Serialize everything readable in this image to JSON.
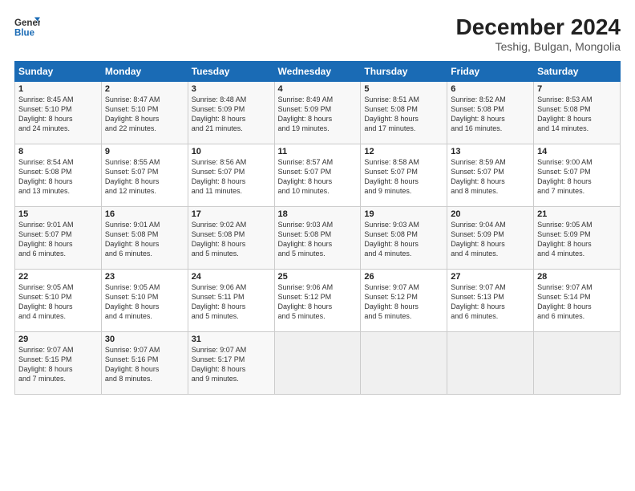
{
  "header": {
    "logo_line1": "General",
    "logo_line2": "Blue",
    "title": "December 2024",
    "subtitle": "Teshig, Bulgan, Mongolia"
  },
  "weekdays": [
    "Sunday",
    "Monday",
    "Tuesday",
    "Wednesday",
    "Thursday",
    "Friday",
    "Saturday"
  ],
  "weeks": [
    [
      {
        "day": "1",
        "info": "Sunrise: 8:45 AM\nSunset: 5:10 PM\nDaylight: 8 hours\nand 24 minutes."
      },
      {
        "day": "2",
        "info": "Sunrise: 8:47 AM\nSunset: 5:10 PM\nDaylight: 8 hours\nand 22 minutes."
      },
      {
        "day": "3",
        "info": "Sunrise: 8:48 AM\nSunset: 5:09 PM\nDaylight: 8 hours\nand 21 minutes."
      },
      {
        "day": "4",
        "info": "Sunrise: 8:49 AM\nSunset: 5:09 PM\nDaylight: 8 hours\nand 19 minutes."
      },
      {
        "day": "5",
        "info": "Sunrise: 8:51 AM\nSunset: 5:08 PM\nDaylight: 8 hours\nand 17 minutes."
      },
      {
        "day": "6",
        "info": "Sunrise: 8:52 AM\nSunset: 5:08 PM\nDaylight: 8 hours\nand 16 minutes."
      },
      {
        "day": "7",
        "info": "Sunrise: 8:53 AM\nSunset: 5:08 PM\nDaylight: 8 hours\nand 14 minutes."
      }
    ],
    [
      {
        "day": "8",
        "info": "Sunrise: 8:54 AM\nSunset: 5:08 PM\nDaylight: 8 hours\nand 13 minutes."
      },
      {
        "day": "9",
        "info": "Sunrise: 8:55 AM\nSunset: 5:07 PM\nDaylight: 8 hours\nand 12 minutes."
      },
      {
        "day": "10",
        "info": "Sunrise: 8:56 AM\nSunset: 5:07 PM\nDaylight: 8 hours\nand 11 minutes."
      },
      {
        "day": "11",
        "info": "Sunrise: 8:57 AM\nSunset: 5:07 PM\nDaylight: 8 hours\nand 10 minutes."
      },
      {
        "day": "12",
        "info": "Sunrise: 8:58 AM\nSunset: 5:07 PM\nDaylight: 8 hours\nand 9 minutes."
      },
      {
        "day": "13",
        "info": "Sunrise: 8:59 AM\nSunset: 5:07 PM\nDaylight: 8 hours\nand 8 minutes."
      },
      {
        "day": "14",
        "info": "Sunrise: 9:00 AM\nSunset: 5:07 PM\nDaylight: 8 hours\nand 7 minutes."
      }
    ],
    [
      {
        "day": "15",
        "info": "Sunrise: 9:01 AM\nSunset: 5:07 PM\nDaylight: 8 hours\nand 6 minutes."
      },
      {
        "day": "16",
        "info": "Sunrise: 9:01 AM\nSunset: 5:08 PM\nDaylight: 8 hours\nand 6 minutes."
      },
      {
        "day": "17",
        "info": "Sunrise: 9:02 AM\nSunset: 5:08 PM\nDaylight: 8 hours\nand 5 minutes."
      },
      {
        "day": "18",
        "info": "Sunrise: 9:03 AM\nSunset: 5:08 PM\nDaylight: 8 hours\nand 5 minutes."
      },
      {
        "day": "19",
        "info": "Sunrise: 9:03 AM\nSunset: 5:08 PM\nDaylight: 8 hours\nand 4 minutes."
      },
      {
        "day": "20",
        "info": "Sunrise: 9:04 AM\nSunset: 5:09 PM\nDaylight: 8 hours\nand 4 minutes."
      },
      {
        "day": "21",
        "info": "Sunrise: 9:05 AM\nSunset: 5:09 PM\nDaylight: 8 hours\nand 4 minutes."
      }
    ],
    [
      {
        "day": "22",
        "info": "Sunrise: 9:05 AM\nSunset: 5:10 PM\nDaylight: 8 hours\nand 4 minutes."
      },
      {
        "day": "23",
        "info": "Sunrise: 9:05 AM\nSunset: 5:10 PM\nDaylight: 8 hours\nand 4 minutes."
      },
      {
        "day": "24",
        "info": "Sunrise: 9:06 AM\nSunset: 5:11 PM\nDaylight: 8 hours\nand 5 minutes."
      },
      {
        "day": "25",
        "info": "Sunrise: 9:06 AM\nSunset: 5:12 PM\nDaylight: 8 hours\nand 5 minutes."
      },
      {
        "day": "26",
        "info": "Sunrise: 9:07 AM\nSunset: 5:12 PM\nDaylight: 8 hours\nand 5 minutes."
      },
      {
        "day": "27",
        "info": "Sunrise: 9:07 AM\nSunset: 5:13 PM\nDaylight: 8 hours\nand 6 minutes."
      },
      {
        "day": "28",
        "info": "Sunrise: 9:07 AM\nSunset: 5:14 PM\nDaylight: 8 hours\nand 6 minutes."
      }
    ],
    [
      {
        "day": "29",
        "info": "Sunrise: 9:07 AM\nSunset: 5:15 PM\nDaylight: 8 hours\nand 7 minutes."
      },
      {
        "day": "30",
        "info": "Sunrise: 9:07 AM\nSunset: 5:16 PM\nDaylight: 8 hours\nand 8 minutes."
      },
      {
        "day": "31",
        "info": "Sunrise: 9:07 AM\nSunset: 5:17 PM\nDaylight: 8 hours\nand 9 minutes."
      },
      null,
      null,
      null,
      null
    ]
  ]
}
